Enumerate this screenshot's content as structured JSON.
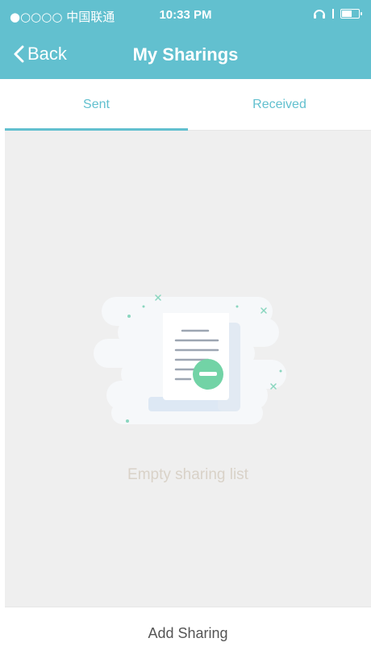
{
  "status_bar": {
    "carrier": "●○○○○ 中国联通",
    "time": "10:33 PM"
  },
  "nav": {
    "back_label": "Back",
    "title": "My Sharings"
  },
  "tabs": [
    {
      "label": "Sent",
      "active": true
    },
    {
      "label": "Received",
      "active": false
    }
  ],
  "empty_state": {
    "icon": "document-minus-icon",
    "message": "Empty sharing list"
  },
  "footer": {
    "add_label": "Add Sharing"
  },
  "colors": {
    "accent": "#62c0cf",
    "minus_badge": "#72d3a6",
    "background": "#efefef"
  }
}
